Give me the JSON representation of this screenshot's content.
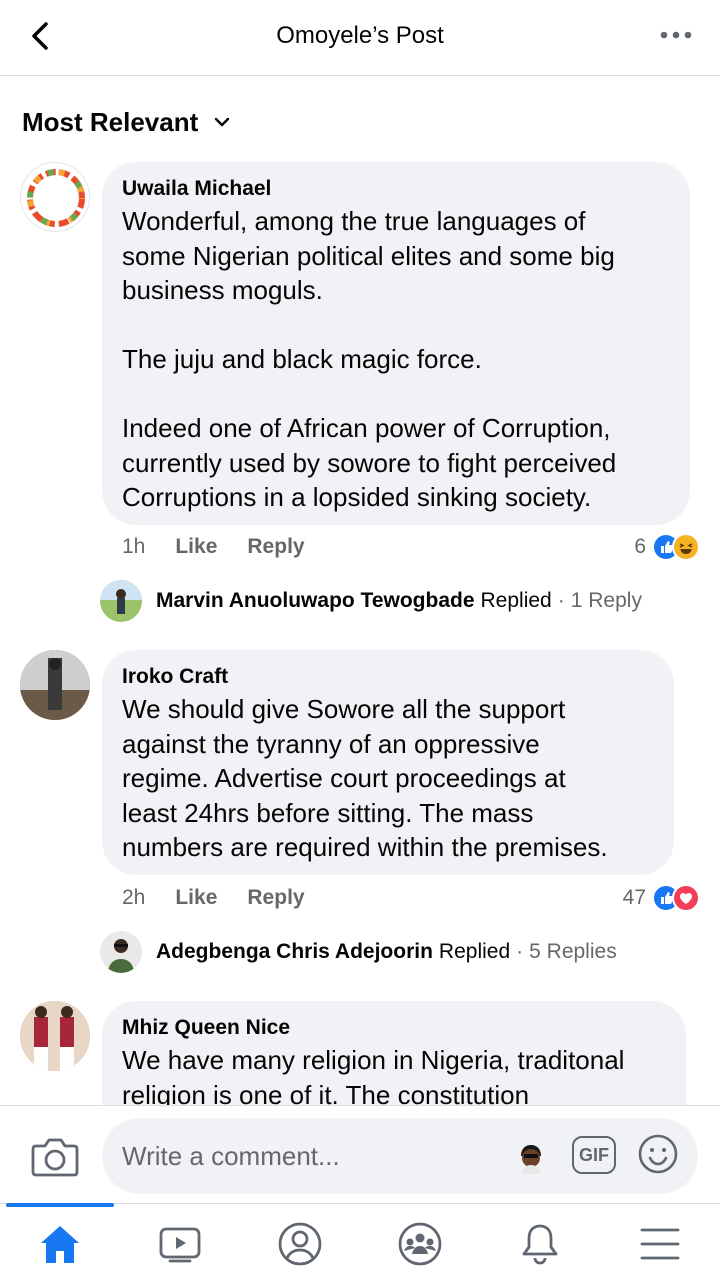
{
  "header": {
    "title": "Omoyele’s Post"
  },
  "sort": {
    "label": "Most Relevant"
  },
  "comments": [
    {
      "author": "Uwaila Michael",
      "text": "Wonderful, among the true languages of\nsome Nigerian political elites and some big\nbusiness moguls.\n\nThe juju and black magic force.\n\nIndeed one of African power of Corruption,\ncurrently used by sowore to fight perceived\nCorruptions in a lopsided sinking society.",
      "time": "1h",
      "like": "Like",
      "reply": "Reply",
      "reaction_count": "6",
      "reactions": [
        "like-icon",
        "haha-icon"
      ],
      "replies": {
        "name": "Marvin Anuoluwapo Tewogbade",
        "word": "Replied",
        "count": "1 Reply"
      }
    },
    {
      "author": "Iroko Craft",
      "text": "We should give Sowore all the support\nagainst the tyranny of an oppressive\nregime. Advertise court proceedings at\nleast 24hrs before sitting. The mass\nnumbers are required within the premises.",
      "time": "2h",
      "like": "Like",
      "reply": "Reply",
      "reaction_count": "47",
      "reactions": [
        "like-icon",
        "love-icon"
      ],
      "replies": {
        "name": "Adegbenga Chris Adejoorin",
        "word": "Replied",
        "count": "5 Replies"
      }
    },
    {
      "author": "Mhiz Queen Nice",
      "text": "We have many religion in Nigeria, traditonal\nreligion is one of it. The constitution"
    }
  ],
  "composer": {
    "placeholder": "Write a comment...",
    "gif": "GIF"
  },
  "colors": {
    "accent": "#1877f2",
    "bubble": "#f0f2f5",
    "secondary_text": "#65676b",
    "love": "#f33e58",
    "haha": "#f7b125"
  },
  "tabs": [
    "home-icon",
    "watch-icon",
    "profile-icon",
    "groups-icon",
    "notifications-icon",
    "menu-icon"
  ]
}
